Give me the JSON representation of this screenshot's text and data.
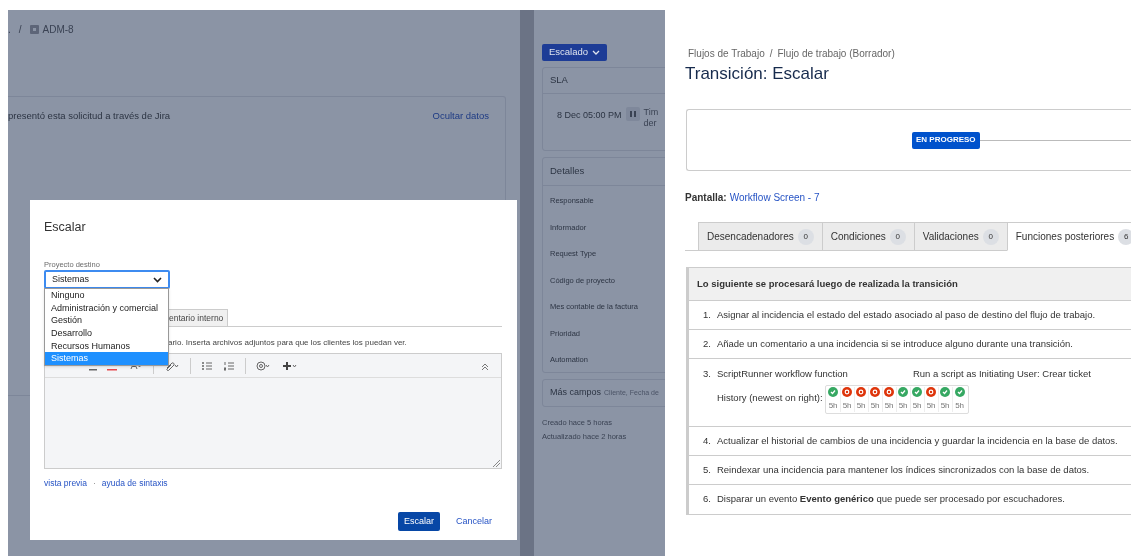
{
  "left_page": {
    "breadcrumb": {
      "prefix": ".",
      "separator": "/",
      "issue_key": "ADM-8"
    },
    "request_panel": {
      "text": "presentó esta solicitud a través de Jira",
      "hide_link": "Ocultar datos"
    },
    "sidebar": {
      "status_button": "Escalado",
      "sla": {
        "title": "SLA",
        "time": "8 Dec 05:00 PM",
        "paused": true,
        "note_line_1": "Tim",
        "note_line_2": "der"
      },
      "details": {
        "title": "Detalles",
        "fields": [
          "Responsable",
          "Informador",
          "Request Type",
          "Código de proyecto",
          "Mes contable de la factura",
          "Prioridad",
          "Automation"
        ]
      },
      "more_fields": {
        "title": "Más campos",
        "hint": "Cliente, Fecha de"
      },
      "created": "Creado hace 5 horas",
      "updated": "Actualizado hace 2 horas"
    }
  },
  "dialog": {
    "title": "Escalar",
    "field_label": "Proyecto destino",
    "select_value": "Sistemas",
    "options": [
      {
        "label": "Ninguno",
        "selected": false
      },
      {
        "label": "Administración y comercial",
        "selected": false
      },
      {
        "label": "Gestión",
        "selected": false
      },
      {
        "label": "Desarrollo",
        "selected": false
      },
      {
        "label": "Recursos Humanos",
        "selected": false
      },
      {
        "label": "Sistemas",
        "selected": true
      }
    ],
    "comment_tab": "entario interno",
    "hint": "ario. Inserta archivos adjuntos para que los clientes los puedan ver.",
    "links": [
      "vista previa",
      "ayuda de sintaxis"
    ],
    "link_separator": "·",
    "buttons": [
      {
        "label": "Escalar",
        "kind": "primary"
      },
      {
        "label": "Cancelar",
        "kind": "link"
      }
    ]
  },
  "workflow_page": {
    "breadcrumb": [
      "Flujos de Trabajo",
      "Flujo de trabajo (Borrador)"
    ],
    "breadcrumb_separator": "/",
    "title": "Transición: Escalar",
    "status_lozenge": "EN PROGRESO",
    "screen_label": "Pantalla:",
    "screen_link": "Workflow Screen - 7",
    "tabs": [
      {
        "label": "Desencadenadores",
        "count": "0",
        "selected": false
      },
      {
        "label": "Condiciones",
        "count": "0",
        "selected": false
      },
      {
        "label": "Validaciones",
        "count": "0",
        "selected": false
      },
      {
        "label": "Funciones posteriores",
        "count": "6",
        "selected": true
      }
    ],
    "table": {
      "header": "Lo siguiente se procesará luego de realizada la transición",
      "rows": [
        {
          "kind": "text",
          "number": "1.",
          "text": "Asignar al incidencia el estado del estado asociado al paso de destino del flujo de trabajo."
        },
        {
          "kind": "text",
          "number": "2.",
          "text": "Añade un comentario a una incidencia si se introduce alguno durante una transición."
        },
        {
          "kind": "script",
          "number": "3.",
          "name": "ScriptRunner workflow function",
          "description": "Run a script as Initiating User: Crear ticket",
          "history_label": "History (newest on right):",
          "runs": [
            {
              "ok": true,
              "age": "5h"
            },
            {
              "ok": false,
              "age": "5h"
            },
            {
              "ok": false,
              "age": "5h"
            },
            {
              "ok": false,
              "age": "5h"
            },
            {
              "ok": false,
              "age": "5h"
            },
            {
              "ok": true,
              "age": "5h"
            },
            {
              "ok": true,
              "age": "5h"
            },
            {
              "ok": false,
              "age": "5h"
            },
            {
              "ok": true,
              "age": "5h"
            },
            {
              "ok": true,
              "age": "5h"
            }
          ]
        },
        {
          "kind": "text",
          "number": "4.",
          "text": "Actualizar el historial de cambios de una incidencia y guardar la incidencia en la base de datos."
        },
        {
          "kind": "text",
          "number": "5.",
          "text": "Reindexar una incidencia para mantener los índices sincronizados con la base de datos."
        },
        {
          "kind": "text",
          "number": "6.",
          "text": "Disparar un evento **Evento genérico** que puede ser procesado por escuchadores."
        }
      ]
    }
  }
}
